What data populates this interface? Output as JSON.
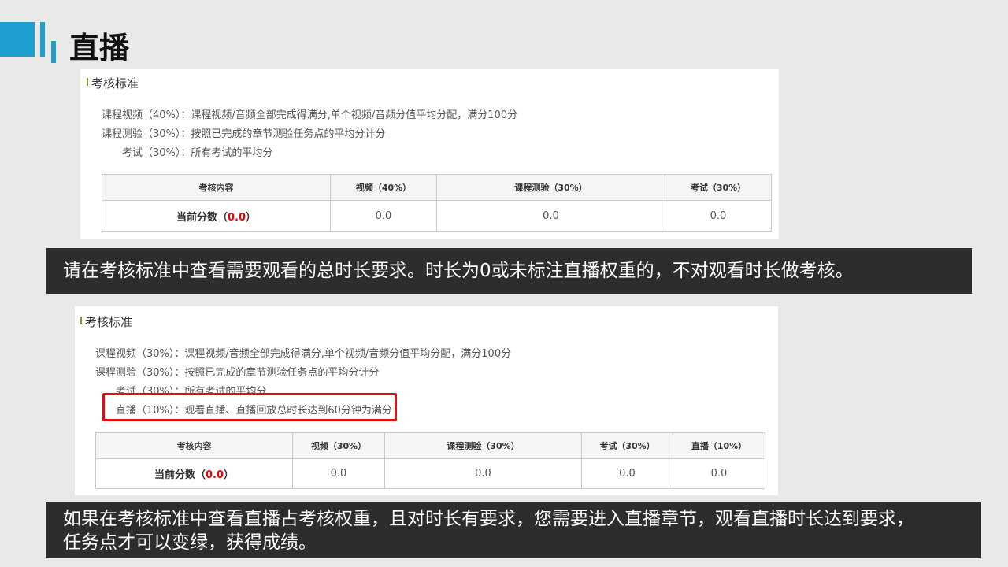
{
  "title": "直播",
  "panel1": {
    "heading": "考核标准",
    "rules": [
      "课程视频（40%）：课程视频/音频全部完成得满分,单个视频/音频分值平均分配，满分100分",
      "课程测验（30%）：按照已完成的章节测验任务点的平均分计分",
      "考试（30%）：所有考试的平均分"
    ],
    "headers": [
      "考核内容",
      "视频（40%）",
      "课程测验（30%）",
      "考试（30%）"
    ],
    "score_label": "当前分数（",
    "score_value": "0.0",
    "score_close": "）",
    "values": [
      "0.0",
      "0.0",
      "0.0"
    ]
  },
  "banner1": "请在考核标准中查看需要观看的总时长要求。时长为0或未标注直播权重的，不对观看时长做考核。",
  "panel2": {
    "heading": "考核标准",
    "rules": [
      "课程视频（30%）：课程视频/音频全部完成得满分,单个视频/音频分值平均分配，满分100分",
      "课程测验（30%）：按照已完成的章节测验任务点的平均分计分",
      "考试（30%）：所有考试的平均分",
      "直播（10%）：观看直播、直播回放总时长达到60分钟为满分"
    ],
    "headers": [
      "考核内容",
      "视频（30%）",
      "课程测验（30%）",
      "考试（30%）",
      "直播（10%）"
    ],
    "score_label": "当前分数（",
    "score_value": "0.0",
    "score_close": "）",
    "values": [
      "0.0",
      "0.0",
      "0.0",
      "0.0"
    ]
  },
  "banner2": [
    "如果在考核标准中查看直播占考核权重，且对时长有要求，您需要进入直播章节，观看直播时长达到要求，",
    "任务点才可以变绿，获得成绩。"
  ]
}
